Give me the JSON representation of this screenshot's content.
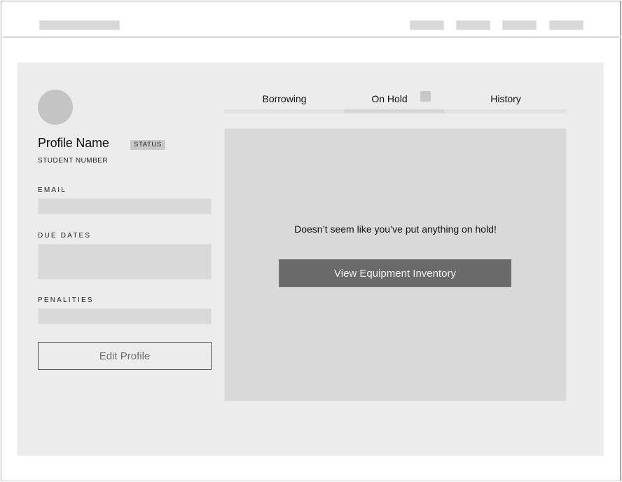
{
  "header": {
    "logo_placeholder": "",
    "nav_items": [
      "",
      "",
      "",
      ""
    ]
  },
  "profile": {
    "name": "Profile Name",
    "status": "STATUS",
    "student_number": "STUDENT NUMBER",
    "fields": {
      "email_label": "EMAIL",
      "email_value": "",
      "due_dates_label": "DUE DATES",
      "due_dates_value": "",
      "penalties_label": "PENALITIES",
      "penalties_value": ""
    },
    "edit_button": "Edit Profile"
  },
  "tabs": {
    "items": [
      {
        "label": "Borrowing",
        "active": false
      },
      {
        "label": "On Hold",
        "active": true
      },
      {
        "label": "History",
        "active": false
      }
    ]
  },
  "content": {
    "empty_message": "Doesn’t seem like you’ve put anything on hold!",
    "inventory_button": "View Equipment Inventory"
  },
  "colors": {
    "panel_bg": "#ececec",
    "placeholder": "#d9d9d9",
    "button_dark": "#6a6a6a",
    "avatar": "#c4c4c4"
  }
}
